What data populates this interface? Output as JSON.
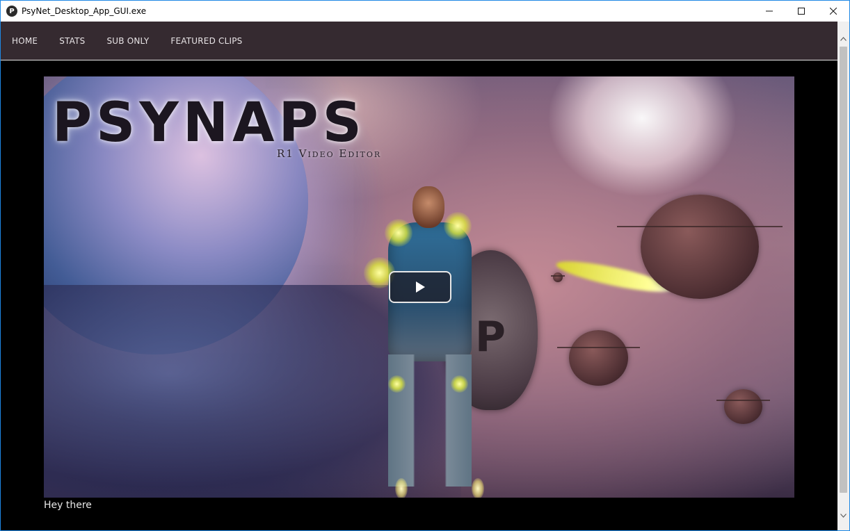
{
  "window": {
    "title": "PsyNet_Desktop_App_GUI.exe",
    "icon_letter": "P"
  },
  "nav": {
    "items": [
      {
        "label": "HOME"
      },
      {
        "label": "STATS"
      },
      {
        "label": "SUB ONLY"
      },
      {
        "label": "FEATURED CLIPS"
      }
    ]
  },
  "video": {
    "logo_text": "PSYNAPS",
    "logo_subtitle": "R1 Video Editor",
    "shield_letter": "P"
  },
  "caption": "Hey there",
  "colors": {
    "navbar_bg": "#352a30",
    "content_bg": "#000000",
    "window_border": "#1e88e5"
  },
  "icons": {
    "minimize": "minimize-icon",
    "maximize": "maximize-icon",
    "close": "close-icon",
    "play": "play-icon"
  }
}
